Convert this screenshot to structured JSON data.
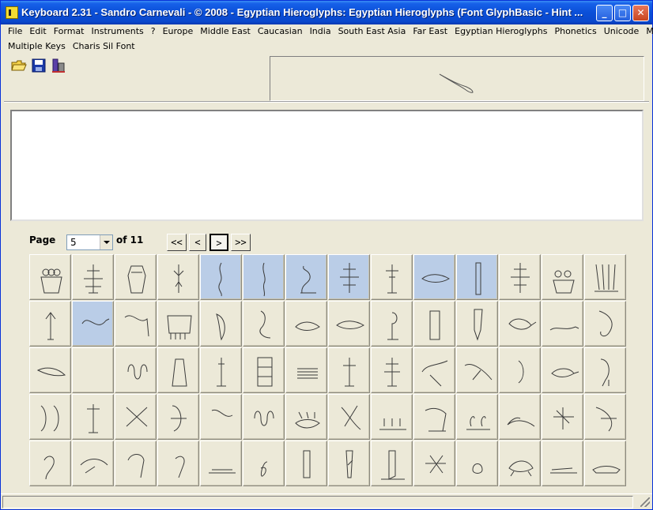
{
  "window": {
    "title": "Keyboard 2.31 - Sandro Carnevali - ©  2008 - Egyptian Hieroglyphs: Egyptian Hieroglyphs (Font GlyphBasic - Hint ...",
    "controls": {
      "minimize": "_",
      "maximize": "□",
      "close": "✕"
    }
  },
  "menu": {
    "row1": [
      "File",
      "Edit",
      "Format",
      "Instruments",
      "?",
      "Europe",
      "Middle East",
      "Caucasian",
      "India",
      "South East Asia",
      "Far East",
      "Egyptian Hieroglyphs",
      "Phonetics",
      "Unicode",
      "More"
    ],
    "row2": [
      "Multiple Keys",
      "Charis Sil Font"
    ]
  },
  "toolbar": {
    "icons": [
      "open-folder-icon",
      "save-disk-icon",
      "keyboard-tool-icon"
    ]
  },
  "pager": {
    "page_label": "Page",
    "current_page": "5",
    "of_label": "of 11",
    "first": "<<",
    "prev": "<",
    "next": ">",
    "last": ">>"
  },
  "glyph_grid": {
    "rows": 5,
    "cols": 14,
    "selected_cells": [
      4,
      5,
      6,
      7,
      9,
      10,
      15
    ]
  },
  "colors": {
    "titlebar": "#0a4fd8",
    "window_bg": "#ece9d8",
    "selected_cell": "#bacde7"
  }
}
